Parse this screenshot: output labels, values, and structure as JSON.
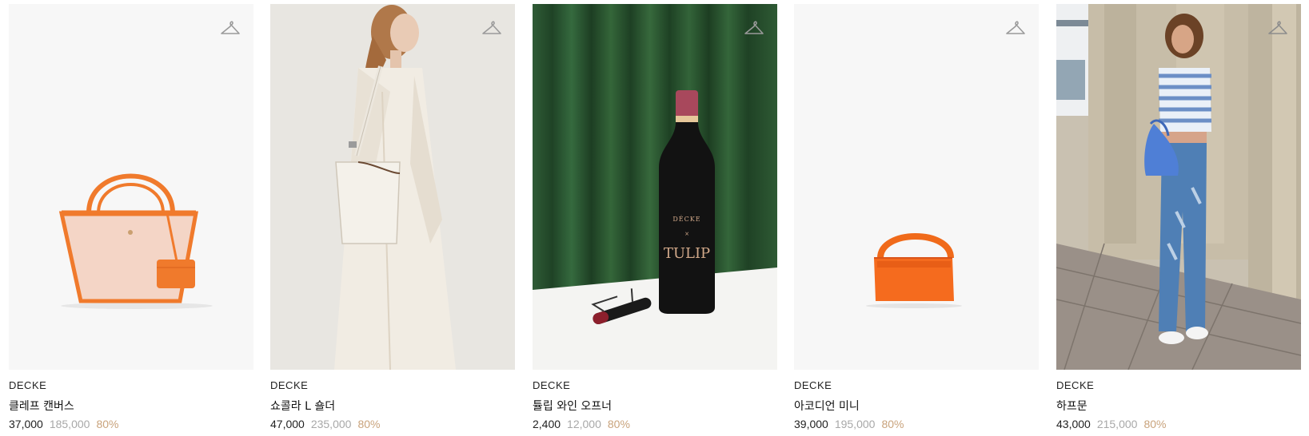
{
  "colors": {
    "price": "#222222",
    "original_price": "#a8a8a8",
    "discount": "#c9a37c"
  },
  "products": [
    {
      "brand": "DECKE",
      "name": "클레프 캔버스",
      "price": "37,000",
      "original_price": "185,000",
      "discount": "80%",
      "wishlist_icon": "hanger-icon"
    },
    {
      "brand": "DECKE",
      "name": "쇼콜라 L 숄더",
      "price": "47,000",
      "original_price": "235,000",
      "discount": "80%",
      "wishlist_icon": "hanger-icon"
    },
    {
      "brand": "DECKE",
      "name": "튤립 와인 오프너",
      "price": "2,400",
      "original_price": "12,000",
      "discount": "80%",
      "wishlist_icon": "hanger-icon",
      "image_label": {
        "brand_mark": "DÉCKE",
        "separator": "×",
        "collab_mark": "TULIP"
      }
    },
    {
      "brand": "DECKE",
      "name": "아코디언 미니",
      "price": "39,000",
      "original_price": "195,000",
      "discount": "80%",
      "wishlist_icon": "hanger-icon"
    },
    {
      "brand": "DECKE",
      "name": "하프문",
      "price": "43,000",
      "original_price": "215,000",
      "discount": "80%",
      "wishlist_icon": "hanger-icon"
    }
  ]
}
